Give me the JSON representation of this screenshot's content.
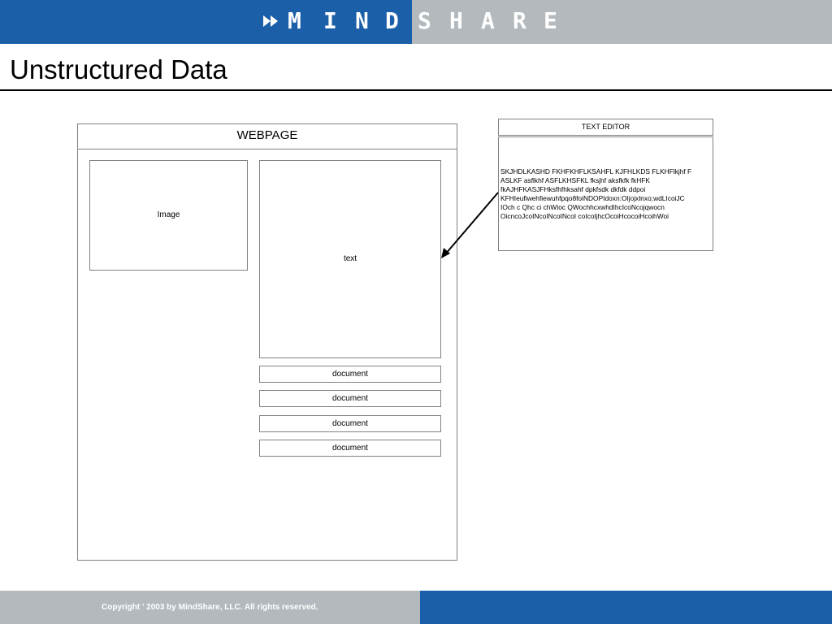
{
  "logo": {
    "arrows_icon": "double-chevron-right-icon",
    "letters_dark": [
      "M",
      "I",
      "N",
      "D"
    ],
    "letters_light": [
      "S",
      "H",
      "A",
      "R",
      "E"
    ]
  },
  "slide": {
    "title": "Unstructured Data"
  },
  "webpage": {
    "label": "WEBPAGE",
    "image_label": "Image",
    "text_label": "text",
    "documents": [
      "document",
      "document",
      "document",
      "document"
    ]
  },
  "text_editor": {
    "title": "TEXT EDITOR",
    "content": "SKJHDLKASHD FKHFKHFLKSAHFL KJFHLKDS FLKHFlkjhf F\nASLKF asflkhf ASFLKHSFKL fksjhf aksfkfk fkHFK\nfkAJHFKASJFHksfhfhksahf   dpkfsdk dkfdk ddpoi\nKFHIeufiwehfiewuhfpqo8foiNDOPIdoxn:OIjojxlnxo;wdLIcoiJC\nIOch c Qhc ci chWioc QWochhcxwhdIhcIcoNcojqwocn\nOicncoJcoINcoINcoINcoI coIcoIjhcOcoiHcocoiHcoihWoi"
  },
  "footer": {
    "copyright": "Copyright ' 2003 by MindShare, LLC.   All rights reserved."
  },
  "colors": {
    "brand_blue": "#1b5fa8",
    "brand_gray": "#b4b9bd"
  }
}
